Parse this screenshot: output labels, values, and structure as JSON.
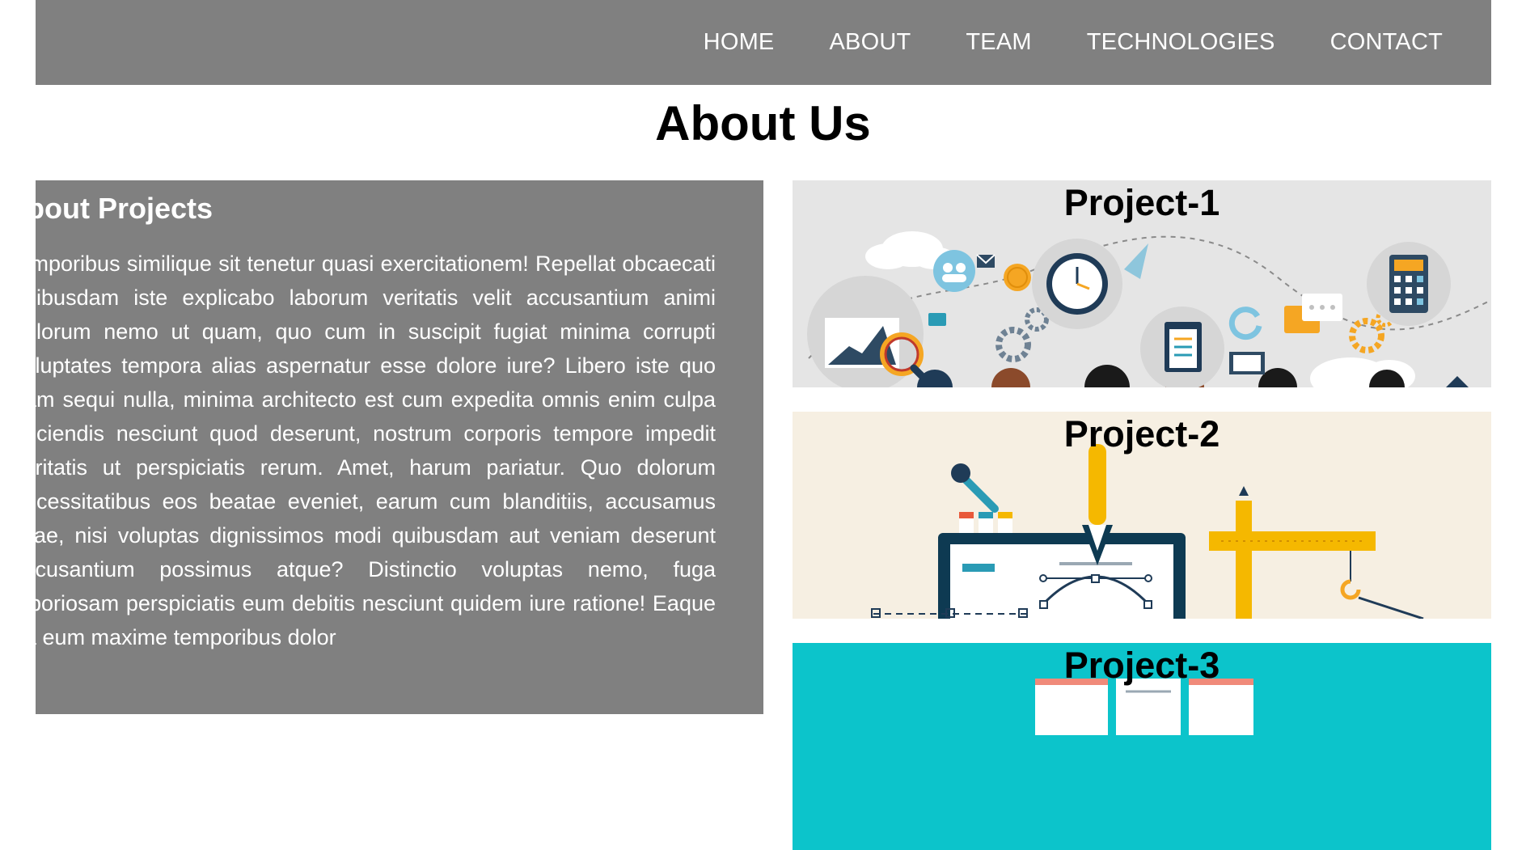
{
  "nav": {
    "items": [
      "HOME",
      "ABOUT",
      "TEAM",
      "TECHNOLOGIES",
      "CONTACT"
    ]
  },
  "page": {
    "title": "About Us"
  },
  "about": {
    "heading": "About Projects",
    "body": "temporibus similique sit tenetur quasi exercitationem! Repellat obcaecati quibusdam iste explicabo laborum veritatis velit accusantium animi dolorum nemo ut quam, quo cum in suscipit fugiat minima corrupti voluptates tempora alias aspernatur esse dolore iure? Libero iste quo nam sequi nulla, minima architecto est cum expedita omnis enim culpa reiciendis nesciunt quod deserunt, nostrum corporis tempore impedit veritatis ut perspiciatis rerum. Amet, harum pariatur. Quo dolorum necessitatibus eos beatae eveniet, earum cum blanditiis, accusamus vitae, nisi voluptas dignissimos modi quibusdam aut veniam deserunt accusantium possimus atque? Distinctio voluptas nemo, fuga laboriosam perspiciatis eum debitis nesciunt quidem iure ratione! Eaque ea eum maxime temporibus dolor"
  },
  "projects": [
    {
      "title": "Project-1",
      "background": "#e5e5e5"
    },
    {
      "title": "Project-2",
      "background": "#f6efe2"
    },
    {
      "title": "Project-3",
      "background": "#0cc4cb"
    }
  ],
  "colors": {
    "navbar": "#808080",
    "panel": "#808080",
    "accent_orange": "#f5a623",
    "navy": "#1f3b57"
  }
}
